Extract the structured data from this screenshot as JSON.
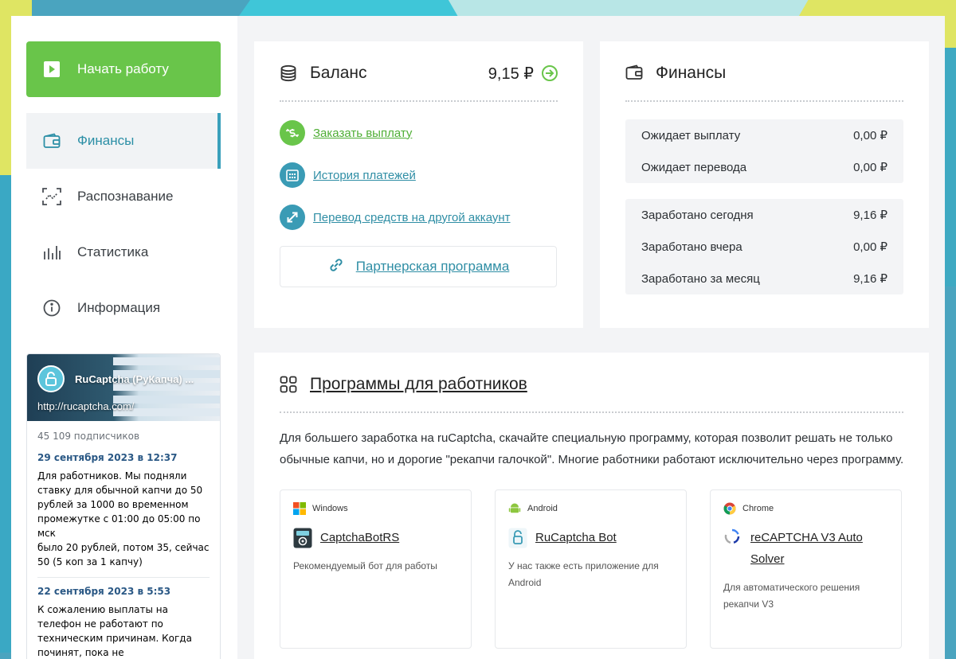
{
  "sidebar": {
    "start_label": "Начать работу",
    "items": [
      {
        "label": "Финансы",
        "icon": "wallet-icon",
        "active": true
      },
      {
        "label": "Распознавание",
        "icon": "scan-icon",
        "active": false
      },
      {
        "label": "Статистика",
        "icon": "bar-chart-icon",
        "active": false
      },
      {
        "label": "Информация",
        "icon": "info-icon",
        "active": false
      }
    ]
  },
  "vk_widget": {
    "group_name": "RuCaptcha (РуКапча) ...",
    "url": "http://rucaptcha.com/",
    "subscribers": "45 109 подписчиков",
    "posts": [
      {
        "date": "29 сентября 2023 в 12:37",
        "text": "Для работников. Мы подняли ставку для обычной капчи до 50 рублей за 1000 во временном промежутке с 01:00 до 05:00 по мск\nбыло 20 рублей, потом 35, сейчас 50 (5 коп за 1 капчу)"
      },
      {
        "date": "22 сентября 2023 в 5:53",
        "text": "К сожалению выплаты на телефон не работают по техническим причинам. Когда починят, пока не"
      }
    ]
  },
  "balance": {
    "title": "Баланс",
    "amount": "9,15 ₽",
    "actions": [
      {
        "label": "Заказать выплату",
        "icon": "dollar-exchange-icon",
        "color": "#69c54a"
      },
      {
        "label": "История платежей",
        "icon": "calendar-icon",
        "color": "#3a9bb5"
      },
      {
        "label": "Перевод средств на другой аккаунт",
        "icon": "transfer-arrows-icon",
        "color": "#3a9bb5"
      }
    ],
    "partner_label": "Партнерская программа"
  },
  "finance": {
    "title": "Финансы",
    "pending": [
      {
        "label": "Ожидает выплату",
        "value": "0,00 ₽"
      },
      {
        "label": "Ожидает перевода",
        "value": "0,00 ₽"
      }
    ],
    "earned": [
      {
        "label": "Заработано сегодня",
        "value": "9,16 ₽"
      },
      {
        "label": "Заработано вчера",
        "value": "0,00 ₽"
      },
      {
        "label": "Заработано за месяц",
        "value": "9,16 ₽"
      }
    ]
  },
  "programs": {
    "title": "Программы для работников",
    "description": "Для большего заработка на ruCaptcha, скачайте специальную программу, которая позволит решать не только обычные капчи, но и дорогие \"рекапчи галочкой\". Многие работники работают исключительно через программу.",
    "tiles": [
      {
        "os": "Windows",
        "app": "CaptchaBotRS",
        "desc": "Рекомендуемый бот для работы"
      },
      {
        "os": "Android",
        "app": "RuCaptcha Bot",
        "desc": "У нас также есть приложение для Android"
      },
      {
        "os": "Chrome",
        "app": "reCAPTCHA V3 Auto Solver",
        "desc": "Для автоматического решения рекапчи V3"
      }
    ]
  },
  "colors": {
    "green": "#69c54a",
    "teal": "#2f8ea5"
  }
}
